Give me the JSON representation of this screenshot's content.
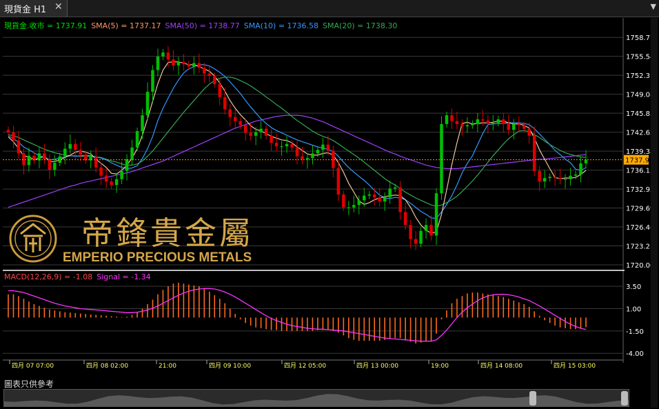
{
  "tab": {
    "title": "現貨金 H1",
    "close_glyph": "✕",
    "menu_glyph": "▼"
  },
  "colors": {
    "background": "#000000",
    "grid": "#3a3a3a",
    "candle_up": "#00c000",
    "candle_down": "#e00000",
    "close_line": "#ff9900",
    "sma5": "#f0c8a0",
    "sma50": "#a040ff",
    "sma10": "#3399ff",
    "sma20": "#33aa55",
    "macd_hist": "#ff6a1a",
    "macd_signal": "#ff33ff",
    "axis_text": "#ffffff",
    "time_text": "#ffff66",
    "price_tag_bg": "#ffaa00"
  },
  "legend": [
    {
      "text": "現貨金.收市 = 1737.91",
      "color": "#00e000"
    },
    {
      "text": "SMA(5) = 1737.17",
      "color": "#ff9966"
    },
    {
      "text": "SMA(50) = 1738.77",
      "color": "#a040ff"
    },
    {
      "text": "SMA(10) = 1736.58",
      "color": "#3399ff"
    },
    {
      "text": "SMA(20) = 1738.30",
      "color": "#33aa55"
    }
  ],
  "macd_legend": [
    {
      "text": "MACD(12,26,9) = -1.08",
      "color": "#ff4444"
    },
    {
      "text": "Signal = -1.34",
      "color": "#ff33ff"
    }
  ],
  "watermark": {
    "cn": "帝鋒貴金屬",
    "en": "EMPERIO PRECIOUS METALS"
  },
  "note": "圖表只供參考",
  "chart_data": {
    "type": "candlestick",
    "last_price": 1737.91,
    "price_axis": {
      "min": 1720.0,
      "max": 1759.5,
      "ticks": [
        "1758.77",
        "1755.54",
        "1752.31",
        "1749.08",
        "1745.85",
        "1742.62",
        "1739.38",
        "1736.15",
        "1732.92",
        "1729.69",
        "1726.46",
        "1723.23",
        "1720.00"
      ]
    },
    "macd_axis": {
      "min": -4.6,
      "max": 4.2,
      "ticks": [
        "3.50",
        "1.00",
        "-1.50",
        "-4.00"
      ]
    },
    "time_labels": [
      "四月 07 07:00",
      "四月 08 02:00",
      "21:00",
      "四月 09 10:00",
      "四月 12 05:00",
      "四月 13 00:00",
      "19:00",
      "四月 14 08:00",
      "四月 15 03:00"
    ],
    "closes": [
      1742.6,
      1741.2,
      1739.0,
      1737.0,
      1738.6,
      1737.8,
      1739.0,
      1738.0,
      1736.2,
      1737.4,
      1738.5,
      1739.8,
      1740.6,
      1739.6,
      1738.8,
      1737.8,
      1738.4,
      1736.6,
      1735.2,
      1734.2,
      1733.6,
      1734.6,
      1736.0,
      1738.0,
      1740.0,
      1742.8,
      1745.5,
      1749.5,
      1753.2,
      1755.5,
      1756.2,
      1755.0,
      1754.0,
      1754.6,
      1754.2,
      1753.8,
      1754.4,
      1753.6,
      1752.6,
      1752.2,
      1750.8,
      1748.6,
      1746.5,
      1745.2,
      1744.5,
      1743.8,
      1742.5,
      1742.0,
      1742.6,
      1743.2,
      1742.0,
      1740.8,
      1740.2,
      1740.2,
      1740.6,
      1740.0,
      1738.5,
      1738.0,
      1738.2,
      1739.0,
      1739.6,
      1740.5,
      1739.5,
      1736.5,
      1732.0,
      1729.8,
      1729.8,
      1730.2,
      1731.0,
      1731.8,
      1732.0,
      1731.5,
      1730.8,
      1731.5,
      1733.0,
      1733.2,
      1729.0,
      1726.8,
      1724.4,
      1723.6,
      1725.8,
      1726.8,
      1725.0,
      1732.2,
      1744.0,
      1745.5,
      1744.5,
      1744.0,
      1743.6,
      1743.8,
      1744.0,
      1744.8,
      1744.6,
      1744.0,
      1744.2,
      1744.8,
      1744.0,
      1743.0,
      1744.0,
      1743.8,
      1743.2,
      1742.0,
      1736.0,
      1734.2,
      1734.8,
      1735.0,
      1734.8,
      1734.6,
      1734.6,
      1735.2,
      1735.4,
      1737.3,
      1737.91
    ],
    "sma5": [
      1741.8,
      1741.0,
      1739.8,
      1738.6,
      1738.4,
      1737.9,
      1738.2,
      1738.5,
      1737.6,
      1737.6,
      1737.9,
      1738.3,
      1738.7,
      1739.2,
      1739.4,
      1739.2,
      1738.9,
      1738.0,
      1737.3,
      1736.6,
      1735.6,
      1735.5,
      1736.1,
      1737.0,
      1738.2,
      1739.8,
      1742.1,
      1744.9,
      1747.9,
      1750.9,
      1753.2,
      1754.5,
      1754.6,
      1754.6,
      1754.4,
      1754.1,
      1754.1,
      1753.8,
      1753.4,
      1753.0,
      1752.2,
      1751.0,
      1749.6,
      1748.0,
      1746.7,
      1745.6,
      1744.7,
      1743.7,
      1743.1,
      1742.8,
      1742.4,
      1741.9,
      1741.6,
      1741.3,
      1741.2,
      1740.8,
      1740.1,
      1739.5,
      1738.9,
      1738.7,
      1738.7,
      1739.0,
      1739.1,
      1738.7,
      1737.4,
      1735.8,
      1733.9,
      1732.4,
      1730.9,
      1730.3,
      1730.6,
      1731.1,
      1731.4,
      1731.6,
      1731.8,
      1731.9,
      1731.8,
      1731.1,
      1729.8,
      1728.1,
      1726.8,
      1725.9,
      1725.4,
      1725.6,
      1728.6,
      1732.8,
      1737.1,
      1740.8,
      1744.1,
      1744.3,
      1744.0,
      1744.1,
      1744.2,
      1744.2,
      1744.3,
      1744.5,
      1744.5,
      1744.2,
      1744.0,
      1744.0,
      1743.8,
      1743.3,
      1741.6,
      1739.6,
      1738.0,
      1736.4,
      1734.9,
      1734.7,
      1734.8,
      1734.8,
      1734.9,
      1735.4,
      1736.1
    ],
    "sma10": [
      1742.0,
      1741.5,
      1740.9,
      1740.1,
      1739.6,
      1739.1,
      1738.6,
      1738.3,
      1737.9,
      1738.0,
      1738.2,
      1738.4,
      1738.6,
      1738.5,
      1738.6,
      1738.7,
      1738.6,
      1738.4,
      1738.2,
      1737.9,
      1737.4,
      1737.0,
      1736.6,
      1736.4,
      1736.5,
      1736.9,
      1738.1,
      1739.8,
      1741.9,
      1744.6,
      1746.7,
      1748.4,
      1750.1,
      1751.5,
      1752.7,
      1753.4,
      1753.8,
      1754.1,
      1754.1,
      1753.9,
      1753.4,
      1752.8,
      1752.1,
      1751.2,
      1750.2,
      1749.2,
      1748.0,
      1746.9,
      1745.9,
      1744.9,
      1744.1,
      1743.4,
      1742.9,
      1742.5,
      1742.1,
      1741.7,
      1741.3,
      1741.0,
      1740.7,
      1740.4,
      1740.1,
      1739.9,
      1739.7,
      1739.3,
      1738.5,
      1737.5,
      1736.6,
      1735.8,
      1735.1,
      1734.4,
      1733.6,
      1732.7,
      1731.9,
      1731.4,
      1731.3,
      1731.5,
      1731.4,
      1731.1,
      1730.5,
      1729.8,
      1729.1,
      1728.6,
      1728.0,
      1727.9,
      1729.0,
      1730.3,
      1731.8,
      1733.6,
      1735.7,
      1737.3,
      1738.6,
      1740.5,
      1742.4,
      1743.9,
      1744.0,
      1744.1,
      1744.1,
      1744.2,
      1744.2,
      1744.2,
      1744.1,
      1743.9,
      1743.2,
      1742.3,
      1741.4,
      1740.5,
      1739.5,
      1738.8,
      1738.0,
      1737.4,
      1736.3,
      1736.1,
      1736.58
    ],
    "sma20": [
      1742.2,
      1742.0,
      1741.7,
      1741.3,
      1740.9,
      1740.5,
      1740.1,
      1739.7,
      1739.4,
      1739.1,
      1738.9,
      1738.7,
      1738.6,
      1738.6,
      1738.5,
      1738.5,
      1738.5,
      1738.4,
      1738.3,
      1738.0,
      1737.7,
      1737.5,
      1737.2,
      1737.0,
      1737.0,
      1737.2,
      1737.7,
      1738.5,
      1739.4,
      1740.5,
      1741.6,
      1742.7,
      1743.8,
      1744.9,
      1746.0,
      1747.0,
      1748.0,
      1749.0,
      1750.0,
      1750.8,
      1751.4,
      1751.8,
      1752.0,
      1752.0,
      1751.8,
      1751.4,
      1751.0,
      1750.5,
      1749.9,
      1749.3,
      1748.6,
      1748.0,
      1747.3,
      1746.7,
      1746.0,
      1745.3,
      1744.6,
      1744.0,
      1743.4,
      1742.8,
      1742.3,
      1741.9,
      1741.6,
      1741.2,
      1740.6,
      1740.0,
      1739.4,
      1738.8,
      1738.2,
      1737.5,
      1736.8,
      1736.1,
      1735.4,
      1734.7,
      1734.1,
      1733.6,
      1733.0,
      1732.4,
      1731.9,
      1731.4,
      1731.0,
      1730.6,
      1730.2,
      1730.0,
      1730.2,
      1730.6,
      1731.1,
      1731.7,
      1732.5,
      1733.4,
      1734.3,
      1735.3,
      1736.4,
      1737.5,
      1738.6,
      1739.6,
      1740.6,
      1741.5,
      1742.2,
      1742.8,
      1742.9,
      1742.7,
      1742.2,
      1741.7,
      1741.1,
      1740.5,
      1740.0,
      1739.5,
      1739.1,
      1738.8,
      1738.6,
      1738.4,
      1738.3
    ],
    "sma50": [
      1729.8,
      1730.1,
      1730.4,
      1730.7,
      1731.0,
      1731.3,
      1731.6,
      1731.9,
      1732.2,
      1732.5,
      1732.8,
      1733.1,
      1733.4,
      1733.6,
      1733.9,
      1734.1,
      1734.3,
      1734.5,
      1734.7,
      1734.9,
      1735.1,
      1735.3,
      1735.5,
      1735.7,
      1735.9,
      1736.2,
      1736.5,
      1736.8,
      1737.1,
      1737.4,
      1737.7,
      1738.1,
      1738.5,
      1738.9,
      1739.3,
      1739.7,
      1740.1,
      1740.5,
      1740.9,
      1741.3,
      1741.7,
      1742.1,
      1742.5,
      1742.9,
      1743.3,
      1743.6,
      1743.9,
      1744.2,
      1744.5,
      1744.7,
      1744.9,
      1745.1,
      1745.3,
      1745.4,
      1745.5,
      1745.5,
      1745.5,
      1745.4,
      1745.2,
      1745.0,
      1744.7,
      1744.4,
      1744.0,
      1743.6,
      1743.2,
      1742.8,
      1742.4,
      1742.0,
      1741.6,
      1741.2,
      1740.8,
      1740.4,
      1740.0,
      1739.6,
      1739.2,
      1738.9,
      1738.5,
      1738.2,
      1737.9,
      1737.6,
      1737.3,
      1737.0,
      1736.8,
      1736.6,
      1736.5,
      1736.4,
      1736.4,
      1736.4,
      1736.5,
      1736.6,
      1736.7,
      1736.8,
      1736.9,
      1737.0,
      1737.1,
      1737.2,
      1737.3,
      1737.4,
      1737.5,
      1737.6,
      1737.7,
      1737.8,
      1737.9,
      1738.0,
      1738.0,
      1738.1,
      1738.2,
      1738.3,
      1738.4,
      1738.5,
      1738.6,
      1738.7,
      1738.77
    ],
    "macd_hist": [
      2.6,
      2.6,
      2.4,
      2.1,
      1.8,
      1.5,
      1.3,
      1.1,
      0.9,
      0.8,
      0.7,
      0.6,
      0.55,
      0.5,
      0.45,
      0.4,
      0.35,
      0.3,
      0.25,
      0.2,
      0.15,
      0.1,
      0.05,
      0.1,
      0.3,
      0.6,
      1.0,
      1.5,
      2.0,
      2.6,
      3.1,
      3.5,
      3.8,
      3.9,
      3.8,
      3.7,
      3.6,
      3.5,
      3.2,
      2.9,
      2.5,
      2.1,
      1.6,
      1.0,
      0.4,
      -0.2,
      -0.6,
      -0.9,
      -1.1,
      -1.2,
      -1.3,
      -1.4,
      -1.4,
      -1.5,
      -1.5,
      -1.5,
      -1.5,
      -1.5,
      -1.5,
      -1.5,
      -1.4,
      -1.4,
      -1.4,
      -1.5,
      -1.7,
      -2.0,
      -2.3,
      -2.5,
      -2.6,
      -2.6,
      -2.6,
      -2.6,
      -2.6,
      -2.5,
      -2.4,
      -2.3,
      -2.3,
      -2.5,
      -2.7,
      -2.9,
      -2.8,
      -2.6,
      -2.6,
      -1.8,
      -0.2,
      0.8,
      1.6,
      2.1,
      2.4,
      2.7,
      2.8,
      2.8,
      2.7,
      2.6,
      2.5,
      2.4,
      2.3,
      2.1,
      1.9,
      1.7,
      1.5,
      1.2,
      0.7,
      0.2,
      -0.3,
      -0.6,
      -0.9,
      -1.1,
      -1.2,
      -1.3,
      -1.3,
      -1.2,
      -1.08
    ],
    "macd_signal": [
      3.0,
      3.0,
      2.9,
      2.8,
      2.6,
      2.4,
      2.2,
      2.0,
      1.8,
      1.6,
      1.45,
      1.3,
      1.2,
      1.1,
      1.0,
      0.95,
      0.9,
      0.85,
      0.8,
      0.75,
      0.7,
      0.65,
      0.6,
      0.55,
      0.55,
      0.6,
      0.7,
      0.85,
      1.05,
      1.3,
      1.6,
      1.9,
      2.2,
      2.5,
      2.75,
      2.95,
      3.1,
      3.2,
      3.25,
      3.25,
      3.2,
      3.05,
      2.85,
      2.6,
      2.3,
      1.95,
      1.6,
      1.25,
      0.9,
      0.55,
      0.2,
      -0.1,
      -0.35,
      -0.55,
      -0.75,
      -0.9,
      -1.0,
      -1.1,
      -1.2,
      -1.25,
      -1.3,
      -1.3,
      -1.35,
      -1.4,
      -1.45,
      -1.5,
      -1.6,
      -1.7,
      -1.8,
      -1.9,
      -2.0,
      -2.1,
      -2.2,
      -2.3,
      -2.35,
      -2.4,
      -2.45,
      -2.5,
      -2.55,
      -2.6,
      -2.65,
      -2.65,
      -2.65,
      -2.5,
      -2.0,
      -1.4,
      -0.7,
      0.0,
      0.6,
      1.1,
      1.5,
      1.9,
      2.2,
      2.4,
      2.55,
      2.6,
      2.6,
      2.55,
      2.45,
      2.3,
      2.1,
      1.9,
      1.6,
      1.3,
      0.95,
      0.6,
      0.25,
      -0.1,
      -0.45,
      -0.75,
      -1.0,
      -1.2,
      -1.34
    ]
  }
}
